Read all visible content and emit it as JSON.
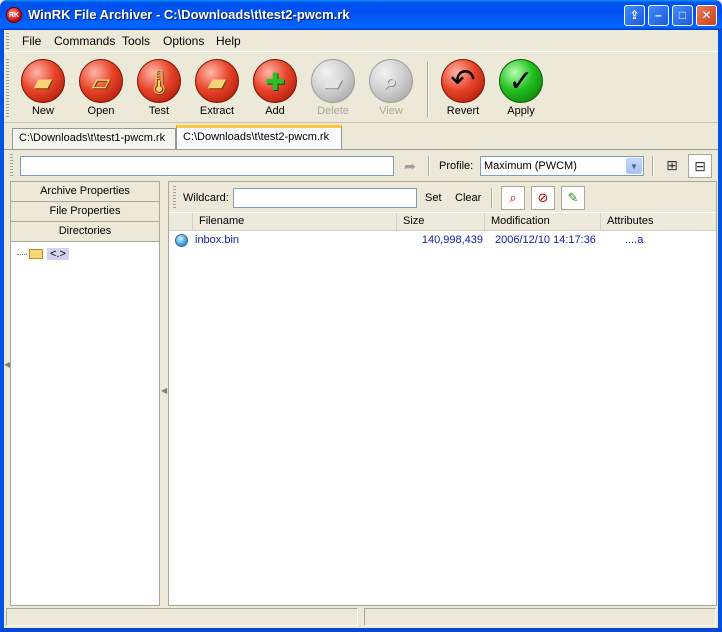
{
  "window": {
    "title": "WinRK File Archiver - C:\\Downloads\\t\\test2-pwcm.rk",
    "app_icon_text": "RK",
    "buttons": {
      "help": "⇪",
      "minimize": "–",
      "maximize": "□",
      "close": "✕"
    }
  },
  "menu": [
    {
      "label": "File"
    },
    {
      "label": "Commands"
    },
    {
      "label": "Tools"
    },
    {
      "label": "Options"
    },
    {
      "label": "Help"
    }
  ],
  "toolbar": {
    "new": "New",
    "open": "Open",
    "test": "Test",
    "extract": "Extract",
    "add": "Add",
    "delete": "Delete",
    "view": "View",
    "revert": "Revert",
    "apply": "Apply"
  },
  "archive_tabs": [
    {
      "label": "C:\\Downloads\\t\\test1-pwcm.rk",
      "active": false
    },
    {
      "label": "C:\\Downloads\\t\\test2-pwcm.rk",
      "active": true
    }
  ],
  "pathbar": {
    "path_value": "",
    "profile_label": "Profile:",
    "profile_value": "Maximum (PWCM)"
  },
  "left_pane": {
    "headers": [
      "Archive Properties",
      "File Properties",
      "Directories"
    ],
    "tree_root": "<.>"
  },
  "wildcard": {
    "label": "Wildcard:",
    "value": "",
    "set": "Set",
    "clear": "Clear"
  },
  "file_list": {
    "columns": [
      "Filename",
      "Size",
      "Modification",
      "Attributes"
    ],
    "rows": [
      {
        "filename": "inbox.bin",
        "size": "140,998,439",
        "modification": "2006/12/10 14:17:36",
        "attributes": "....a"
      }
    ]
  },
  "colors": {
    "titlebar": "#0054e3",
    "row_text": "#1020a0",
    "active_tab_accent": "#ffc83c"
  }
}
